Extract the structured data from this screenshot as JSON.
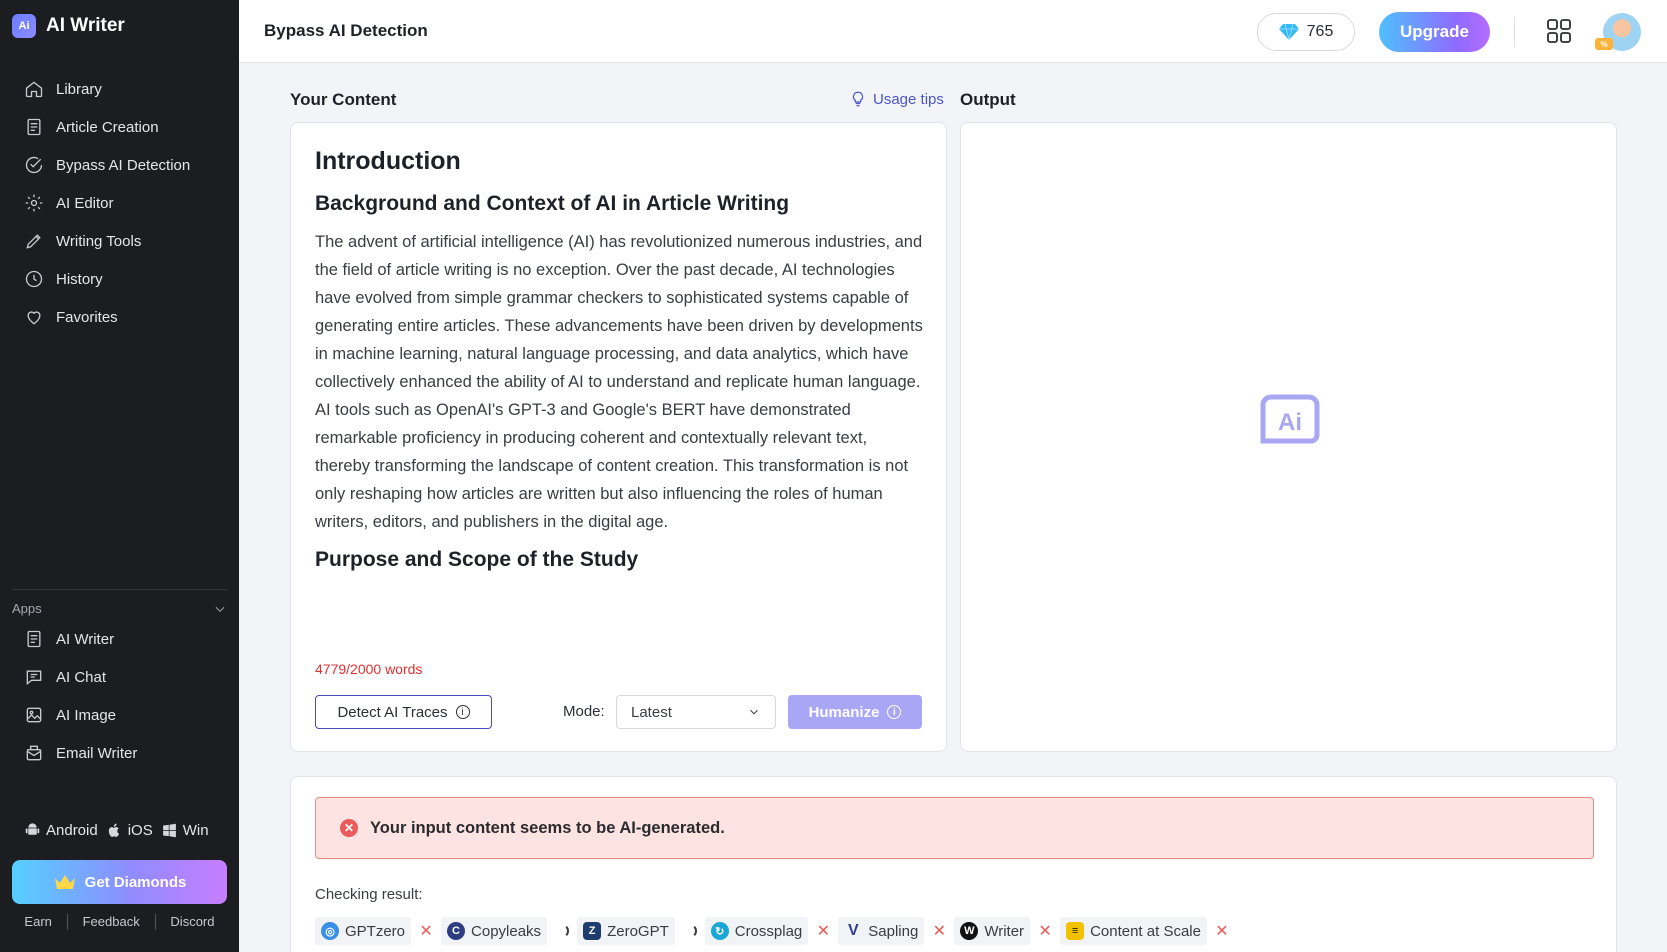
{
  "app": {
    "name": "AI Writer",
    "logo_text": "Ai"
  },
  "sidebar": {
    "nav": [
      {
        "label": "Library",
        "icon": "home-icon"
      },
      {
        "label": "Article Creation",
        "icon": "document-icon"
      },
      {
        "label": "Bypass AI Detection",
        "icon": "check-circle-icon"
      },
      {
        "label": "AI Editor",
        "icon": "gear-icon"
      },
      {
        "label": "Writing Tools",
        "icon": "pencil-icon"
      },
      {
        "label": "History",
        "icon": "clock-icon"
      },
      {
        "label": "Favorites",
        "icon": "heart-icon"
      }
    ],
    "apps_title": "Apps",
    "apps": [
      {
        "label": "AI Writer",
        "icon": "document-icon"
      },
      {
        "label": "AI Chat",
        "icon": "chat-icon"
      },
      {
        "label": "AI Image",
        "icon": "image-icon"
      },
      {
        "label": "Email Writer",
        "icon": "mail-icon"
      }
    ],
    "platforms": [
      "Android",
      "iOS",
      "Win"
    ],
    "get_diamonds": "Get Diamonds",
    "footer": [
      "Earn",
      "Feedback",
      "Discord"
    ]
  },
  "header": {
    "title": "Bypass AI Detection",
    "diamonds": "765",
    "upgrade": "Upgrade"
  },
  "main": {
    "your_content": "Your Content",
    "usage_tips": "Usage tips",
    "output": "Output",
    "content": {
      "h1": "Introduction",
      "h2a": "Background and Context of AI in Article Writing",
      "paragraph": "The advent of artificial intelligence (AI) has revolutionized numerous industries, and the field of article writing is no exception. Over the past decade, AI technologies have evolved from simple grammar checkers to sophisticated systems capable of generating entire articles. These advancements have been driven by developments in machine learning, natural language processing, and data analytics, which have collectively enhanced the ability of AI to understand and replicate human language. AI tools such as OpenAI's GPT-3 and Google's BERT have demonstrated remarkable proficiency in producing coherent and contextually relevant text, thereby transforming the landscape of content creation. This transformation is not only reshaping how articles are written but also influencing the roles of human writers, editors, and publishers in the digital age.",
      "h2b": "Purpose and Scope of the Study"
    },
    "word_count": "4779/2000 words",
    "detect_btn": "Detect AI Traces",
    "mode_label": "Mode:",
    "mode_value": "Latest",
    "humanize_btn": "Humanize",
    "output_placeholder": "Ai"
  },
  "result": {
    "alert": "Your input content seems to be AI-generated.",
    "checking_label": "Checking result:",
    "detectors": [
      {
        "name": "GPTzero",
        "status": "fail",
        "icon_color": "#3a8ee6"
      },
      {
        "name": "Copyleaks",
        "status": "loading",
        "icon_color": "#2d3e82"
      },
      {
        "name": "ZeroGPT",
        "status": "loading",
        "icon_color": "#1e3c6e"
      },
      {
        "name": "Crossplag",
        "status": "fail",
        "icon_color": "#1aa7d6"
      },
      {
        "name": "Sapling",
        "status": "fail",
        "icon_color": "#2f3f8f"
      },
      {
        "name": "Writer",
        "status": "fail",
        "icon_color": "#111111"
      },
      {
        "name": "Content at Scale",
        "status": "fail",
        "icon_color": "#f2c200"
      }
    ]
  }
}
